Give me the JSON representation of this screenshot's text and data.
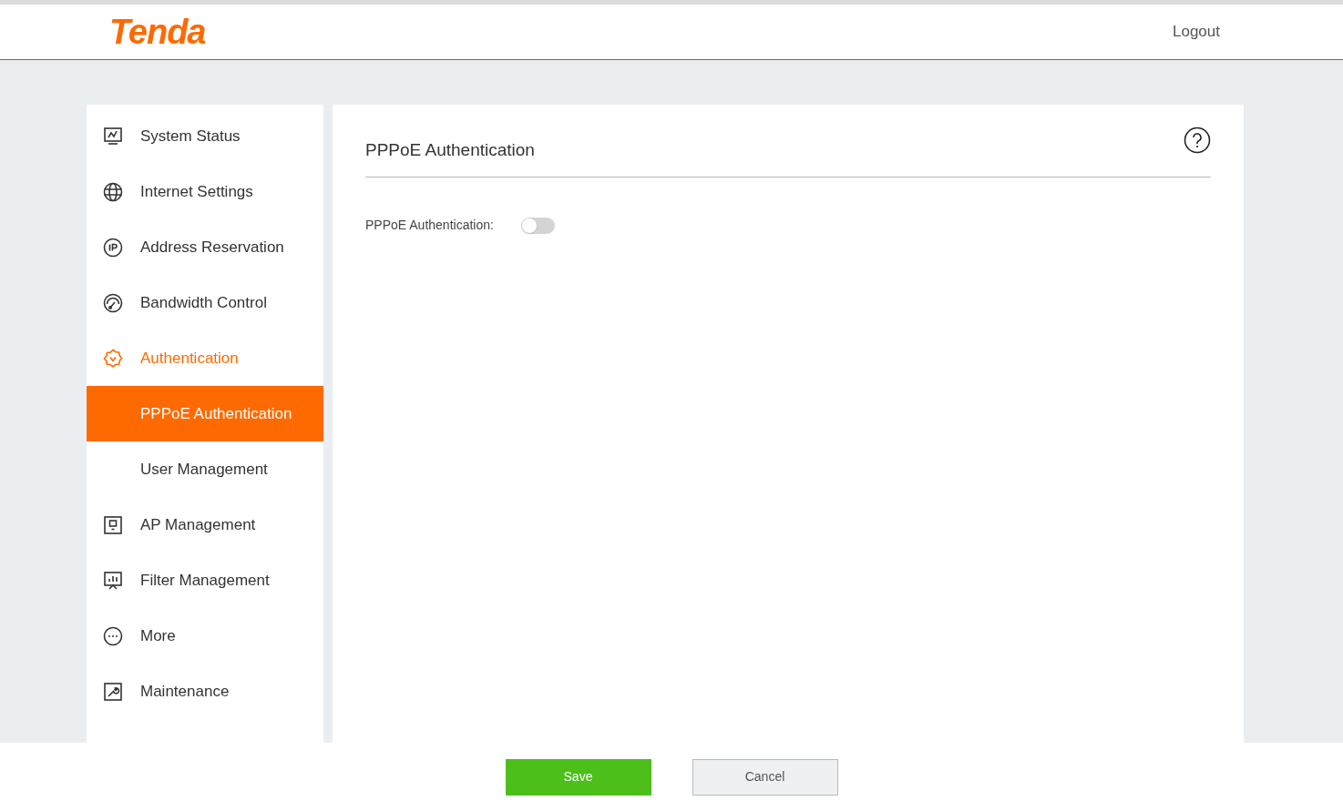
{
  "header": {
    "logo": "Tenda",
    "logout": "Logout"
  },
  "sidebar": {
    "items": [
      {
        "kind": "status",
        "label": "System Status",
        "selected": false,
        "expanded": false
      },
      {
        "kind": "globe",
        "label": "Internet Settings",
        "selected": false,
        "expanded": false
      },
      {
        "kind": "ip",
        "label": "Address Reservation",
        "selected": false,
        "expanded": false
      },
      {
        "kind": "gauge",
        "label": "Bandwidth Control",
        "selected": false,
        "expanded": false
      },
      {
        "kind": "badge",
        "label": "Authentication",
        "selected": false,
        "expanded": true
      },
      {
        "kind": "sub",
        "label": "PPPoE Authentication",
        "selected": true
      },
      {
        "kind": "sub",
        "label": "User Management",
        "selected": false
      },
      {
        "kind": "ap",
        "label": "AP Management",
        "selected": false,
        "expanded": false
      },
      {
        "kind": "filter",
        "label": "Filter Management",
        "selected": false,
        "expanded": false
      },
      {
        "kind": "more",
        "label": "More",
        "selected": false,
        "expanded": false
      },
      {
        "kind": "wrench",
        "label": "Maintenance",
        "selected": false,
        "expanded": false
      }
    ]
  },
  "panel": {
    "title": "PPPoE Authentication",
    "fields": [
      {
        "label": "PPPoE Authentication:",
        "on": false
      }
    ]
  },
  "footer": {
    "buttons": [
      {
        "kind": "primary",
        "label": "Save"
      },
      {
        "kind": "secondary",
        "label": "Cancel"
      }
    ]
  }
}
